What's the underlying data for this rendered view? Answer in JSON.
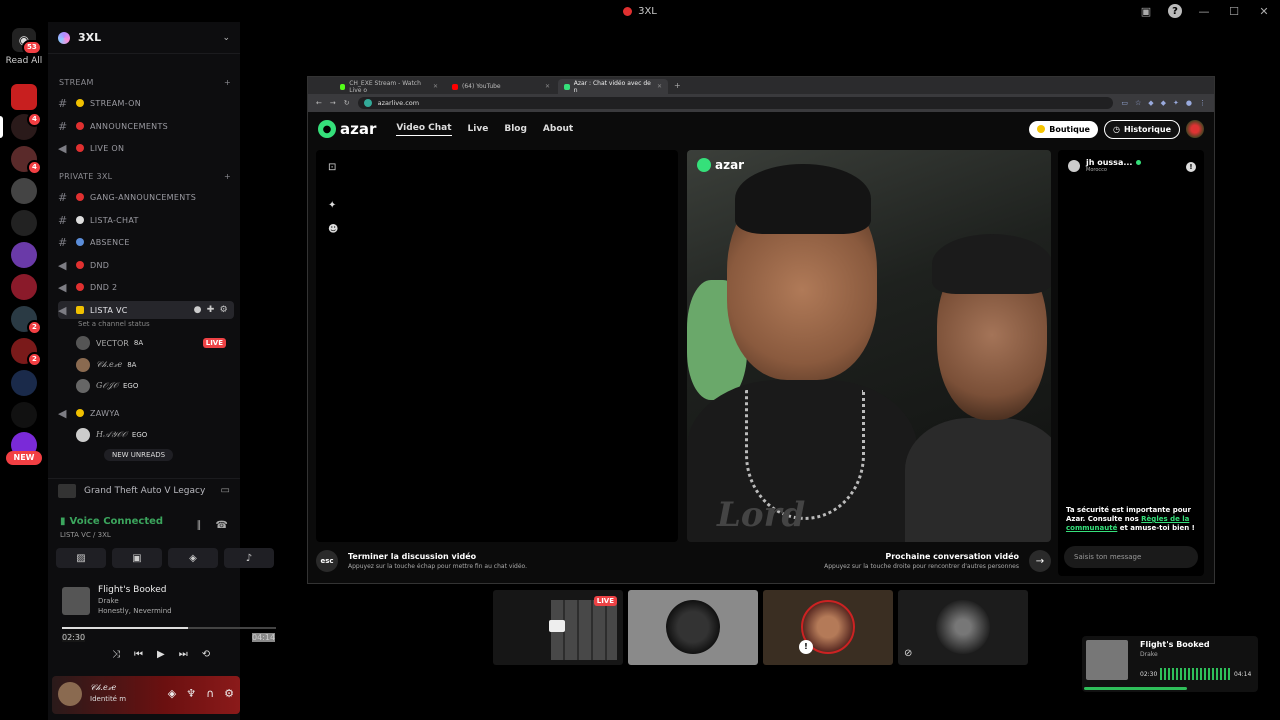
{
  "window": {
    "title": "3XL"
  },
  "rail": {
    "home_badge": "53",
    "read_all": "Read All",
    "new_label": "NEW",
    "badges": [
      "4",
      "4",
      "2",
      "2"
    ]
  },
  "guild": {
    "name": "3XL"
  },
  "categories": [
    {
      "name": "STREAM"
    },
    {
      "name": "PRIVATE 3XL"
    }
  ],
  "channels": [
    {
      "name": "STREAM-ON",
      "color": "#f0c000"
    },
    {
      "name": "ANNOUNCEMENTS",
      "color": "#e03030"
    },
    {
      "name": "LIVE ON",
      "color": "#e03030"
    },
    {
      "name": "GANG-ANNOUNCEMENTS",
      "color": "#e03030"
    },
    {
      "name": "LISTA-CHAT",
      "color": "#dddddd"
    },
    {
      "name": "ABSENCE",
      "color": "#5b8dd9"
    },
    {
      "name": "DND",
      "color": "#e03030"
    },
    {
      "name": "DND 2",
      "color": "#e03030"
    },
    {
      "name": "LISTA VC",
      "color": "#f0c000"
    },
    {
      "name": "ZAWYA",
      "color": "#f0c000"
    }
  ],
  "channel_status": "Set a channel status",
  "voice_users": [
    {
      "name": "VECTOR",
      "tag": "8A",
      "live": "LIVE"
    },
    {
      "name": "𝒞𝒽.𝑒𝓍𝑒",
      "tag": "8A"
    },
    {
      "name": "𝐺𝒪𝒥𝒪",
      "tag": "EGO"
    },
    {
      "name": "𝐻𝒜𝒴𝒪𝒪",
      "tag": "EGO"
    }
  ],
  "new_unreads": "NEW UNREADS",
  "activity": {
    "game": "Grand Theft Auto V Legacy"
  },
  "voice": {
    "status": "Voice Connected",
    "channel": "LISTA VC / 3XL"
  },
  "player": {
    "song": "Flight's Booked",
    "artist": "Drake",
    "album": "Honestly, Nevermind",
    "elapsed": "02:30",
    "total": "04:14",
    "progress": 0.59
  },
  "user": {
    "name": "𝒞𝒽.𝑒𝓍𝑒",
    "status": "Identité m"
  },
  "browser": {
    "tabs": [
      {
        "title": "CH_EXE Stream - Watch Live o",
        "color": "#53fc18"
      },
      {
        "title": "(64) YouTube",
        "color": "#ff0000"
      },
      {
        "title": "Azar : Chat vidéo avec de n",
        "color": "#35e07a"
      }
    ],
    "url": "azarlive.com"
  },
  "site": {
    "logo": "azar",
    "nav": [
      "Video Chat",
      "Live",
      "Blog",
      "About"
    ],
    "boutique": "Boutique",
    "historique": "Historique",
    "end_title": "Terminer la discussion vidéo",
    "end_sub": "Appuyez sur la touche échap pour mettre fin au chat vidéo.",
    "esc": "esc",
    "next_title": "Prochaine conversation vidéo",
    "next_sub": "Appuyez sur la touche droite pour rencontrer d'autres personnes",
    "peer_name": "jh oussa...",
    "peer_country": "Morocco",
    "safety_a": "Ta sécurité est importante pour Azar. Consulte nos ",
    "safety_link": "Règles de la communauté",
    "safety_b": " et amuse-toi bien !",
    "message_placeholder": "Saisis ton message",
    "shirt_text": "Lord"
  },
  "stream_tiles": [
    {
      "live": "LIVE"
    }
  ],
  "mini_player": {
    "song": "Flight's Booked",
    "artist": "Drake",
    "elapsed": "02:30",
    "total": "04:14",
    "progress": 0.6
  }
}
